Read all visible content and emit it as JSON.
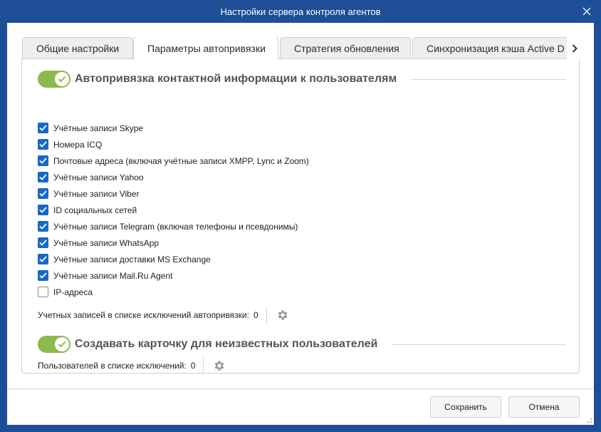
{
  "window": {
    "title": "Настройки сервера контроля агентов",
    "close_icon": "close-icon"
  },
  "tabs": [
    {
      "label": "Общие настройки",
      "active": false
    },
    {
      "label": "Параметры автопривязки",
      "active": true
    },
    {
      "label": "Стратегия обновления",
      "active": false
    },
    {
      "label": "Синхронизация кэша Active D",
      "active": false
    }
  ],
  "tab_scroll_icon": "chevron-right-icon",
  "autobind": {
    "enabled": true,
    "title": "Автопривязка контактной информации к пользователям",
    "items": [
      {
        "label": "Учётные записи Skype",
        "checked": true
      },
      {
        "label": "Номера ICQ",
        "checked": true
      },
      {
        "label": "Почтовые адреса (включая учётные записи XMPP, Lync и Zoom)",
        "checked": true
      },
      {
        "label": "Учётные записи Yahoo",
        "checked": true
      },
      {
        "label": "Учётные записи Viber",
        "checked": true
      },
      {
        "label": "ID социальных сетей",
        "checked": true
      },
      {
        "label": "Учётные записи Telegram (включая телефоны и псевдонимы)",
        "checked": true
      },
      {
        "label": "Учётные записи WhatsApp",
        "checked": true
      },
      {
        "label": "Учётные записи доставки MS Exchange",
        "checked": true
      },
      {
        "label": "Учётные записи Mail.Ru Agent",
        "checked": true
      },
      {
        "label": "IP-адреса",
        "checked": false
      }
    ],
    "exclusions_label": "Учетных записей в списке исключений автопривязки:",
    "exclusions_count": "0"
  },
  "unknown_users": {
    "enabled": true,
    "title": "Создавать карточку для неизвестных пользователей",
    "exclusions_label": "Пользователей в списке исключений:",
    "exclusions_count": "0"
  },
  "footer": {
    "save_label": "Сохранить",
    "cancel_label": "Отмена"
  },
  "colors": {
    "frame": "#1d4e96",
    "toggle_on": "#8dba4c",
    "checkbox_checked": "#1868c7"
  }
}
